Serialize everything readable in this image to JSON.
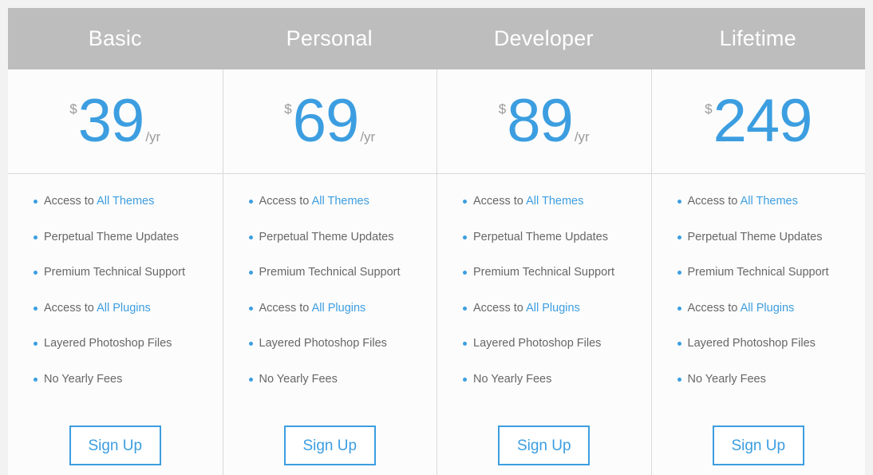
{
  "theme": {
    "accent_color": "#3c9ee0",
    "header_band_color": "#bdbdbd",
    "page_background": "#f2f2f2",
    "card_background": "#fcfcfc",
    "feature_text_color": "#676767",
    "muted_color": "#9a9a9a",
    "divider_color": "#d9d9d9"
  },
  "currency_symbol": "$",
  "signup_label": "Sign Up",
  "plans": [
    {
      "name": "Basic",
      "currency": "$",
      "amount": "39",
      "period": "/yr",
      "features": [
        {
          "prefix": "Access to ",
          "link": "All Themes",
          "suffix": ""
        },
        {
          "prefix": "Perpetual Theme Updates",
          "link": "",
          "suffix": ""
        },
        {
          "prefix": "Premium Technical Support",
          "link": "",
          "suffix": ""
        },
        {
          "prefix": "Access to ",
          "link": "All Plugins",
          "suffix": ""
        },
        {
          "prefix": "Layered Photoshop Files",
          "link": "",
          "suffix": ""
        },
        {
          "prefix": "No Yearly Fees",
          "link": "",
          "suffix": ""
        }
      ],
      "signup_label": "Sign Up"
    },
    {
      "name": "Personal",
      "currency": "$",
      "amount": "69",
      "period": "/yr",
      "features": [
        {
          "prefix": "Access to ",
          "link": "All Themes",
          "suffix": ""
        },
        {
          "prefix": "Perpetual Theme Updates",
          "link": "",
          "suffix": ""
        },
        {
          "prefix": "Premium Technical Support",
          "link": "",
          "suffix": ""
        },
        {
          "prefix": "Access to ",
          "link": "All Plugins",
          "suffix": ""
        },
        {
          "prefix": "Layered Photoshop Files",
          "link": "",
          "suffix": ""
        },
        {
          "prefix": "No Yearly Fees",
          "link": "",
          "suffix": ""
        }
      ],
      "signup_label": "Sign Up"
    },
    {
      "name": "Developer",
      "currency": "$",
      "amount": "89",
      "period": "/yr",
      "features": [
        {
          "prefix": "Access to ",
          "link": "All Themes",
          "suffix": ""
        },
        {
          "prefix": "Perpetual Theme Updates",
          "link": "",
          "suffix": ""
        },
        {
          "prefix": "Premium Technical Support",
          "link": "",
          "suffix": ""
        },
        {
          "prefix": "Access to ",
          "link": "All Plugins",
          "suffix": ""
        },
        {
          "prefix": "Layered Photoshop Files",
          "link": "",
          "suffix": ""
        },
        {
          "prefix": "No Yearly Fees",
          "link": "",
          "suffix": ""
        }
      ],
      "signup_label": "Sign Up"
    },
    {
      "name": "Lifetime",
      "currency": "$",
      "amount": "249",
      "period": "",
      "features": [
        {
          "prefix": "Access to ",
          "link": "All Themes",
          "suffix": ""
        },
        {
          "prefix": "Perpetual Theme Updates",
          "link": "",
          "suffix": ""
        },
        {
          "prefix": "Premium Technical Support",
          "link": "",
          "suffix": ""
        },
        {
          "prefix": "Access to ",
          "link": "All Plugins",
          "suffix": ""
        },
        {
          "prefix": "Layered Photoshop Files",
          "link": "",
          "suffix": ""
        },
        {
          "prefix": "No Yearly Fees",
          "link": "",
          "suffix": ""
        }
      ],
      "signup_label": "Sign Up"
    }
  ]
}
